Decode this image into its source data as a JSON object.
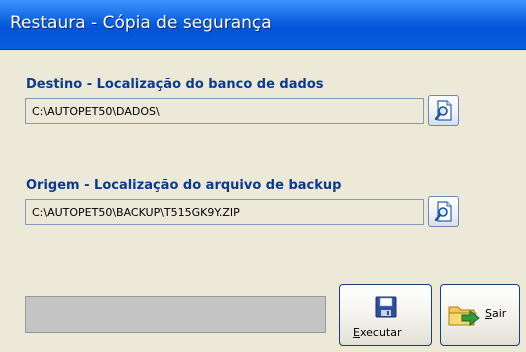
{
  "window": {
    "title": "Restaura - Cópia de segurança"
  },
  "destino": {
    "label": "Destino - Localização do banco de dados",
    "value": "C:\\AUTOPET50\\DADOS\\"
  },
  "origem": {
    "label": "Origem - Localização do arquivo de backup",
    "value": "C:\\AUTOPET50\\BACKUP\\T515GK9Y.ZIP"
  },
  "progress": {
    "value": 0
  },
  "buttons": {
    "executar": {
      "mnemonic": "E",
      "label_rest": "xecutar",
      "icon": "floppy-disk-icon"
    },
    "sair": {
      "mnemonic": "S",
      "label_rest": "air",
      "icon": "exit-folder-icon"
    },
    "browse_icon": "search-document-icon"
  },
  "colors": {
    "titlebar": "#0a5fdf",
    "label_text": "#0b3a8e",
    "window_bg": "#ece9d8"
  }
}
